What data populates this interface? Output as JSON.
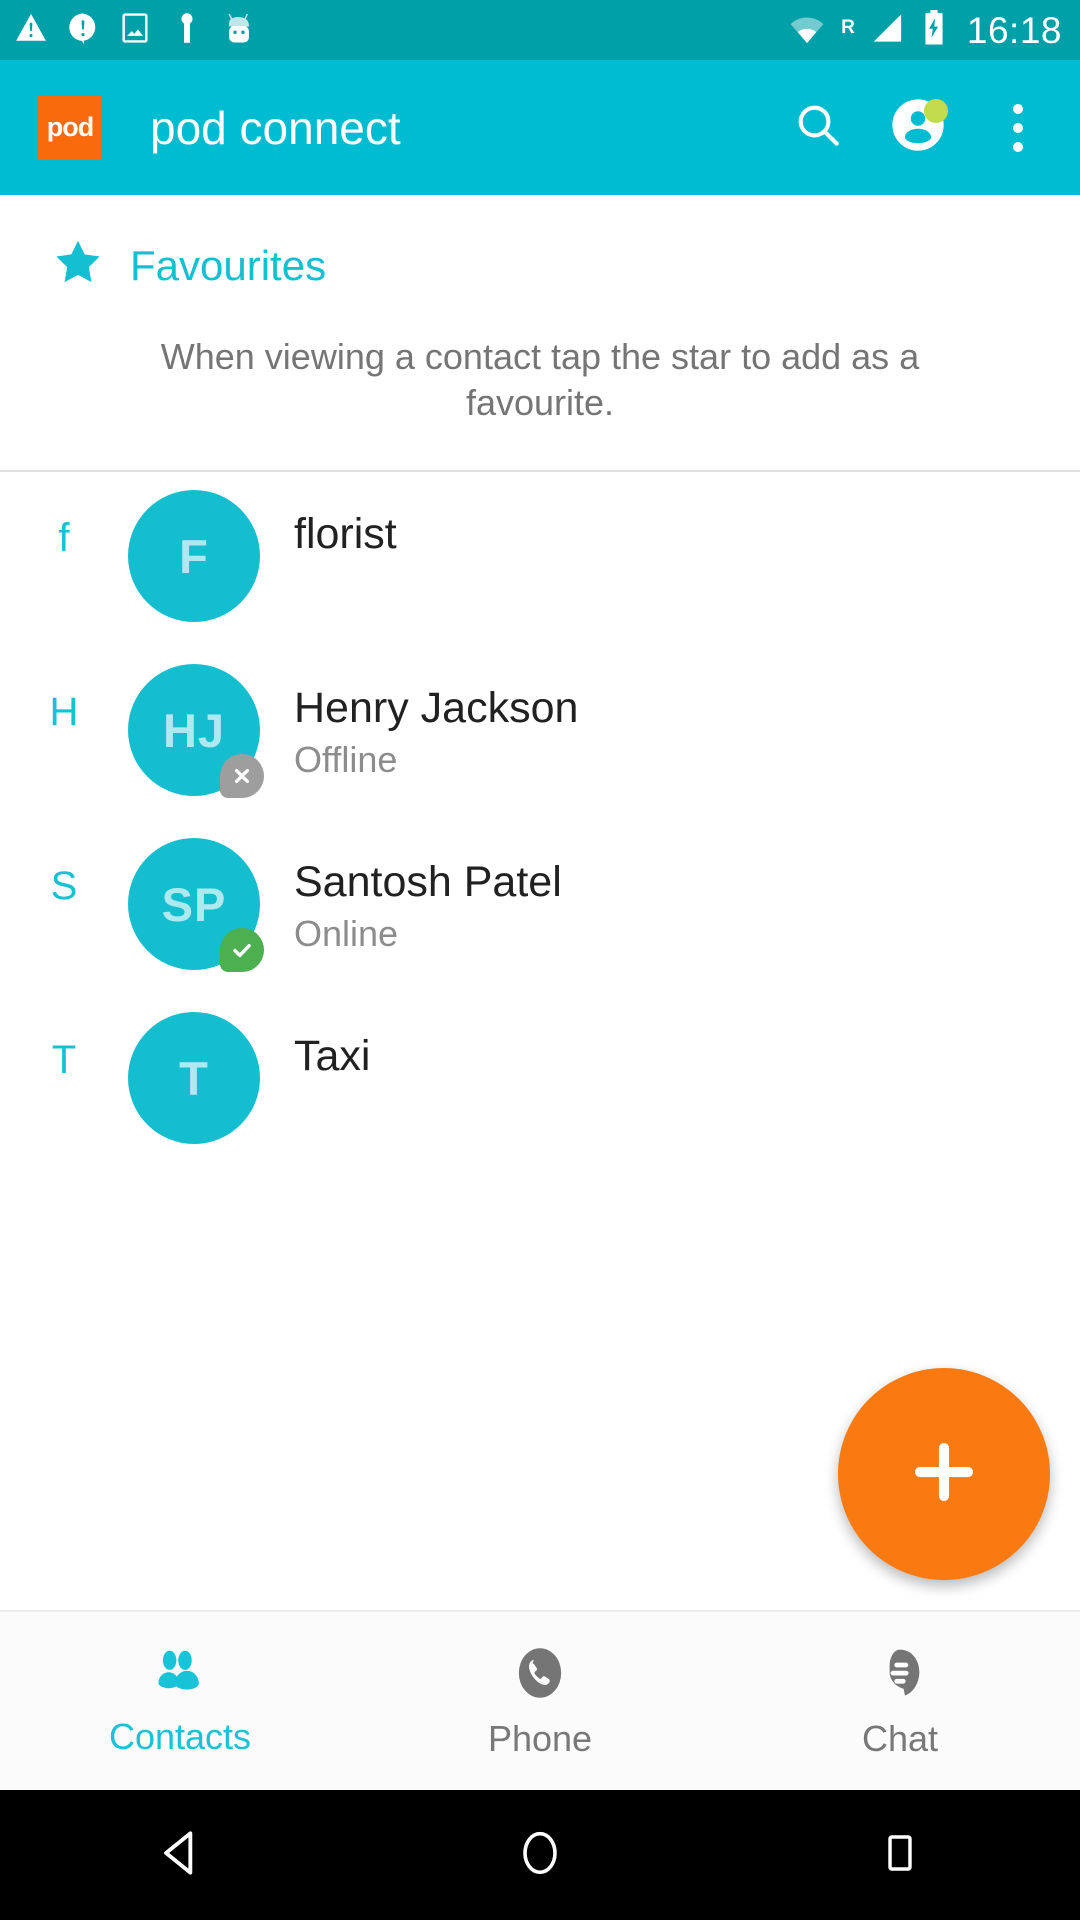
{
  "status_bar": {
    "icons": [
      "warning-triangle-icon",
      "alert-circle-icon",
      "image-icon",
      "usb-key-icon",
      "android-robot-icon"
    ],
    "wifi": "wifi-icon",
    "roaming_label": "R",
    "signal": "signal-icon",
    "battery": "battery-charging-icon",
    "time": "16:18",
    "background_color": "#00A0A8"
  },
  "app_bar": {
    "logo_text": "pod",
    "logo_color": "#F96A0D",
    "title": "pod connect",
    "background_color": "#00BCD0",
    "actions": [
      {
        "name": "search-icon",
        "label": "Search"
      },
      {
        "name": "account-icon",
        "label": "Account",
        "badge_color": "#C2DB4A"
      },
      {
        "name": "overflow-menu-icon",
        "label": "More options"
      }
    ]
  },
  "favourites": {
    "title": "Favourites",
    "icon": "star-icon",
    "accent_color": "#14BFD2",
    "empty_message": "When viewing a contact tap the star to add as a favourite."
  },
  "contacts": [
    {
      "section_letter": "f",
      "initials": "F",
      "name": "florist",
      "status": "",
      "presence": ""
    },
    {
      "section_letter": "H",
      "initials": "HJ",
      "name": "Henry Jackson",
      "status": "Offline",
      "presence": "offline"
    },
    {
      "section_letter": "S",
      "initials": "SP",
      "name": "Santosh Patel",
      "status": "Online",
      "presence": "online"
    },
    {
      "section_letter": "T",
      "initials": "T",
      "name": "Taxi",
      "status": "",
      "presence": ""
    }
  ],
  "fab": {
    "icon": "plus-icon",
    "label": "Add contact",
    "color": "#F97A10"
  },
  "bottom_nav": {
    "active_color": "#17C3D6",
    "inactive_color": "#787878",
    "tabs": [
      {
        "label": "Contacts",
        "icon": "contacts-icon",
        "active": true
      },
      {
        "label": "Phone",
        "icon": "phone-icon",
        "active": false
      },
      {
        "label": "Chat",
        "icon": "chat-icon",
        "active": false
      }
    ]
  },
  "android_nav": {
    "back": "back-triangle-icon",
    "home": "home-circle-icon",
    "recents": "recents-square-icon"
  }
}
